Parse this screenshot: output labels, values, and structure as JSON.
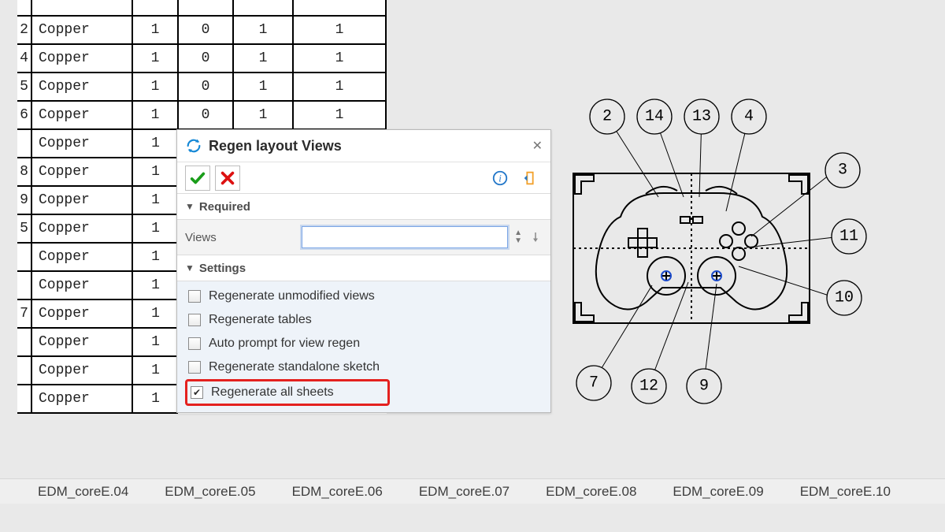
{
  "table": {
    "rows": [
      {
        "idx": "2",
        "material": "Copper",
        "c1": "1",
        "c2": "0",
        "c3": "1",
        "c4": "1",
        "truncated": false
      },
      {
        "idx": "4",
        "material": "Copper",
        "c1": "1",
        "c2": "0",
        "c3": "1",
        "c4": "1",
        "truncated": false
      },
      {
        "idx": "5",
        "material": "Copper",
        "c1": "1",
        "c2": "0",
        "c3": "1",
        "c4": "1",
        "truncated": false
      },
      {
        "idx": "6",
        "material": "Copper",
        "c1": "1",
        "c2": "0",
        "c3": "1",
        "c4": "1",
        "truncated": false
      },
      {
        "idx": "",
        "material": "Copper",
        "c1": "1",
        "c2": "",
        "c3": "",
        "c4": "",
        "truncated": true
      },
      {
        "idx": "8",
        "material": "Copper",
        "c1": "1",
        "c2": "",
        "c3": "",
        "c4": "",
        "truncated": true
      },
      {
        "idx": "9",
        "material": "Copper",
        "c1": "1",
        "c2": "",
        "c3": "",
        "c4": "",
        "truncated": true
      },
      {
        "idx": "5",
        "material": "Copper",
        "c1": "1",
        "c2": "",
        "c3": "",
        "c4": "",
        "truncated": true
      },
      {
        "idx": "",
        "material": "Copper",
        "c1": "1",
        "c2": "",
        "c3": "",
        "c4": "",
        "truncated": true
      },
      {
        "idx": "",
        "material": "Copper",
        "c1": "1",
        "c2": "",
        "c3": "",
        "c4": "",
        "truncated": true
      },
      {
        "idx": "7",
        "material": "Copper",
        "c1": "1",
        "c2": "",
        "c3": "",
        "c4": "",
        "truncated": true
      },
      {
        "idx": "",
        "material": "Copper",
        "c1": "1",
        "c2": "",
        "c3": "",
        "c4": "",
        "truncated": true
      },
      {
        "idx": "",
        "material": "Copper",
        "c1": "1",
        "c2": "",
        "c3": "",
        "c4": "",
        "truncated": true
      },
      {
        "idx": "",
        "material": "Copper",
        "c1": "1",
        "c2": "",
        "c3": "",
        "c4": "",
        "truncated": true
      }
    ]
  },
  "dialog": {
    "title": "Regen layout Views",
    "sections": {
      "required": {
        "label": "Required",
        "views_label": "Views",
        "views_value": ""
      },
      "settings": {
        "label": "Settings",
        "opts": [
          {
            "label": "Regenerate unmodified views",
            "checked": false
          },
          {
            "label": "Regenerate tables",
            "checked": false
          },
          {
            "label": "Auto prompt for view regen",
            "checked": false
          },
          {
            "label": "Regenerate standalone sketch",
            "checked": false
          },
          {
            "label": "Regenerate all sheets",
            "checked": true
          }
        ]
      }
    },
    "highlight_index": 4
  },
  "balloons": [
    "2",
    "14",
    "13",
    "4",
    "3",
    "11",
    "10",
    "7",
    "12",
    "9"
  ],
  "sheets": [
    "EDM_coreE.04",
    "EDM_coreE.05",
    "EDM_coreE.06",
    "EDM_coreE.07",
    "EDM_coreE.08",
    "EDM_coreE.09",
    "EDM_coreE.10"
  ]
}
